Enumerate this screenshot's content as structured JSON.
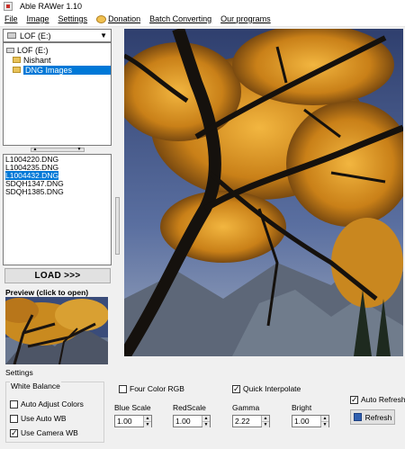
{
  "window": {
    "title": "Able RAWer 1.10"
  },
  "menu": {
    "file": "File",
    "image": "Image",
    "settings": "Settings",
    "donation": "Donation",
    "batch": "Batch Converting",
    "programs": "Our programs"
  },
  "drive_select": {
    "value": "LOF (E:)"
  },
  "tree": {
    "items": [
      "LOF (E:)",
      "Nishant",
      "DNG Images"
    ]
  },
  "files": [
    "L1004220.DNG",
    "L1004235.DNG",
    "L1004432.DNG",
    "SDQH1347.DNG",
    "SDQH1385.DNG"
  ],
  "load_button": "LOAD >>>",
  "preview_label": "Preview (click to open)",
  "settings_caption": "Settings",
  "white_balance": {
    "title": "White Balance",
    "auto_adjust": "Auto Adjust Colors",
    "auto_wb": "Use Auto WB",
    "camera_wb": "Use Camera WB"
  },
  "options": {
    "four_color": "Four Color RGB",
    "quick_interpolate": "Quick Interpolate",
    "auto_refresh": "Auto Refresh"
  },
  "params": {
    "blue_scale_label": "Blue Scale",
    "blue_scale": "1.00",
    "red_scale_label": "RedScale",
    "red_scale": "1.00",
    "gamma_label": "Gamma",
    "gamma": "2.22",
    "bright_label": "Bright",
    "bright": "1.00"
  },
  "refresh_button": "Refresh",
  "checks": {
    "auto_adjust": false,
    "auto_wb": false,
    "camera_wb": true,
    "four_color": false,
    "quick_interpolate": true,
    "auto_refresh": true
  },
  "selected_file_index": 2,
  "selected_folder": "DNG Images"
}
